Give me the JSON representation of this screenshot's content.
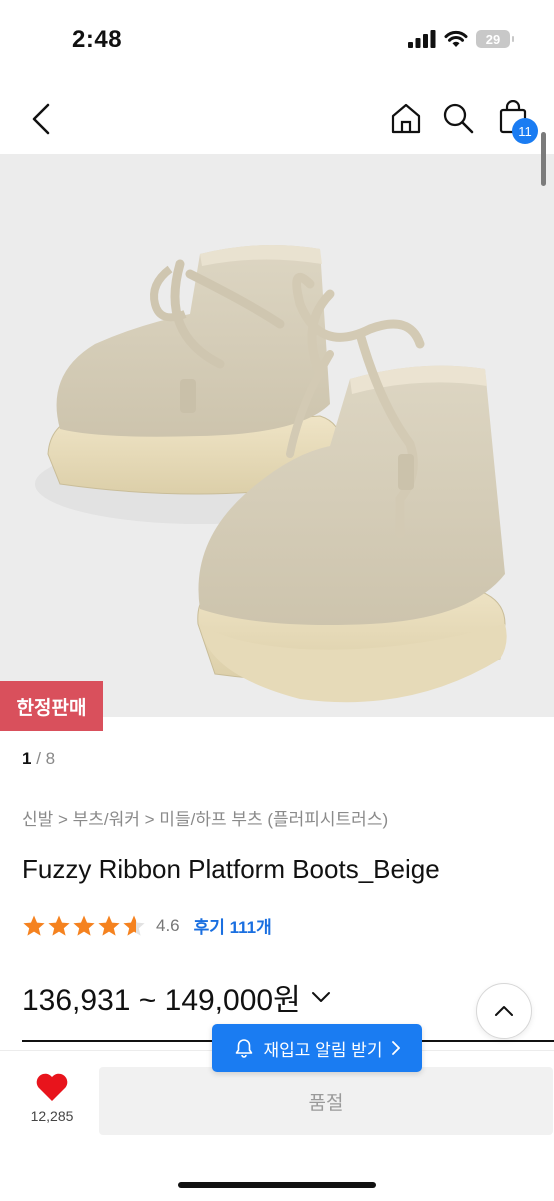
{
  "status_bar": {
    "time": "2:48",
    "battery": "29"
  },
  "header": {
    "cart_count": "11"
  },
  "product": {
    "limited_badge": "한정판매",
    "image_index": "1",
    "image_total": "/ 8",
    "breadcrumb": "신발 > 부츠/워커 > 미들/하프 부츠 (플러피시트러스)",
    "title": "Fuzzy Ribbon Platform Boots_Beige",
    "rating": "4.6",
    "rating_stars": 4.6,
    "reviews": "후기 111개",
    "price": "136,931 ~ 149,000원"
  },
  "bottom": {
    "like_count": "12,285",
    "soldout_label": "품절",
    "restock_label": "재입고 알림 받기"
  },
  "colors": {
    "accent_blue": "#1a7cf2",
    "badge_red": "#d9505c",
    "star": "#f5821f",
    "heart": "#e8141c"
  }
}
